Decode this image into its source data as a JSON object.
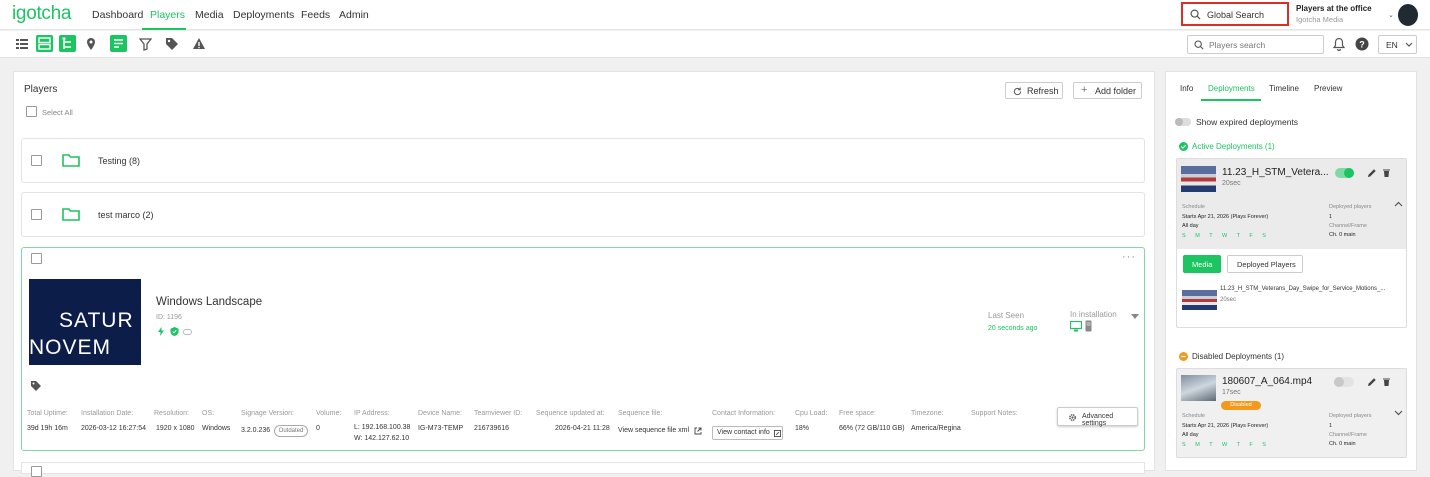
{
  "app": {
    "logo": "igotcha"
  },
  "nav": {
    "items": [
      "Dashboard",
      "Players",
      "Media",
      "Deployments",
      "Feeds",
      "Admin"
    ],
    "active": "Players"
  },
  "header": {
    "global_search": "Global Search",
    "account_name": "Players at the office",
    "account_org": "Igotcha Media"
  },
  "toolbar": {
    "icons": [
      "list-view-icon",
      "grid-view-icon",
      "tree-view-icon",
      "location-icon",
      "details-view-icon",
      "filter-icon",
      "tag-icon",
      "warning-icon"
    ],
    "players_search_placeholder": "Players search",
    "language": "EN"
  },
  "players_panel": {
    "title": "Players",
    "select_all": "Select All",
    "refresh": "Refresh",
    "add_folder": "Add folder",
    "folders": [
      {
        "label": "Testing (8)"
      },
      {
        "label": "test marco (2)"
      }
    ]
  },
  "player": {
    "name": "Windows Landscape",
    "id": "ID: 1196",
    "thumbnail_text": [
      "SATUR",
      "NOVEM"
    ],
    "last_seen_label": "Last Seen",
    "last_seen_value": "20 seconds ago",
    "status": "In installation",
    "details": {
      "total_uptime": {
        "label": "Total Uptime:",
        "value": "39d 19h 16m"
      },
      "installation_date": {
        "label": "Installation Date:",
        "value": "2026-03-12 16:27:54"
      },
      "resolution": {
        "label": "Resolution:",
        "value": "1920 x 1080"
      },
      "os": {
        "label": "OS:",
        "value": "Windows"
      },
      "signage_version": {
        "label": "Signage Version:",
        "value": "3.2.0.236",
        "badge": "Outdated"
      },
      "volume": {
        "label": "Volume:",
        "value": "0"
      },
      "ip_address": {
        "label": "IP Address:",
        "value_l": "L: 192.168.100.38",
        "value_w": "W: 142.127.62.10"
      },
      "device_name": {
        "label": "Device Name:",
        "value": "IG-M73-TEMP"
      },
      "teamviewer_id": {
        "label": "Teamviewer ID:",
        "value": "216739616"
      },
      "sequence_updated": {
        "label": "Sequence updated at:",
        "value": "2026-04-21 11:28"
      },
      "sequence_file": {
        "label": "Sequence file:",
        "value": "View sequence file xml"
      },
      "contact_info": {
        "label": "Contact Information:",
        "value": "View contact info"
      },
      "cpu_load": {
        "label": "Cpu Load:",
        "value": "18%"
      },
      "free_space": {
        "label": "Free space:",
        "value": "66% (72 GB/110 GB)"
      },
      "timezone": {
        "label": "Timezone:",
        "value": "America/Regina"
      },
      "support_notes": {
        "label": "Support Notes:",
        "value": ""
      }
    },
    "advanced_settings": "Advanced settings"
  },
  "side_panel": {
    "tabs": [
      "Info",
      "Deployments",
      "Timeline",
      "Preview"
    ],
    "active_tab": "Deployments",
    "show_expired": "Show expired deployments",
    "active": {
      "heading": "Active Deployments (1)",
      "title": "11.23_H_STM_Vetera...",
      "duration": "20sec",
      "schedule_label": "Schedule",
      "schedule_value": "Starts Apr 21, 2026 (Plays Forever)",
      "allday": "All day",
      "days": "S M T W T F S",
      "deployed_label": "Deployed players",
      "deployed_value": "1",
      "channel_label": "Channel/Frame",
      "channel_value": "Ch. 0 main",
      "media_btn": "Media",
      "deployed_btn": "Deployed Players",
      "media_title": "11.23_H_STM_Veterans_Day_Swipe_for_Service_Motions_...",
      "media_duration": "20sec"
    },
    "disabled": {
      "heading": "Disabled Deployments (1)",
      "title": "180607_A_064.mp4",
      "duration": "17sec",
      "badge": "Disabled",
      "schedule_label": "Schedule",
      "schedule_value": "Starts Apr 21, 2026 (Plays Forever)",
      "allday": "All day",
      "days": "S M T W T F S",
      "deployed_label": "Deployed players",
      "deployed_value": "1",
      "channel_label": "Channel/Frame",
      "channel_value": "Ch. 0 main"
    }
  },
  "colors": {
    "accent": "#1cc462",
    "warning": "#f29a1e",
    "highlight": "#d93025"
  }
}
